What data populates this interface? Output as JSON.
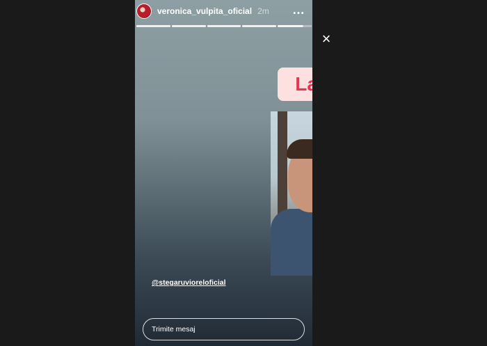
{
  "header": {
    "username": "veronica_vulpita_oficial",
    "time": "2m",
    "more_icon": "…"
  },
  "progress": {
    "segments": 5,
    "active_index": 4,
    "active_fill": 0.75
  },
  "close_label": "×",
  "story": {
    "caption": "La mulți ani!!!",
    "mention": "@stegaruvioreloficial",
    "sticker_icon": "sparkling-heart"
  },
  "reply": {
    "placeholder": "Trimite mesaj"
  },
  "colors": {
    "background": "#1a1a1a",
    "caption_bg": "#fde0e0",
    "caption_text": "#e8344e"
  }
}
